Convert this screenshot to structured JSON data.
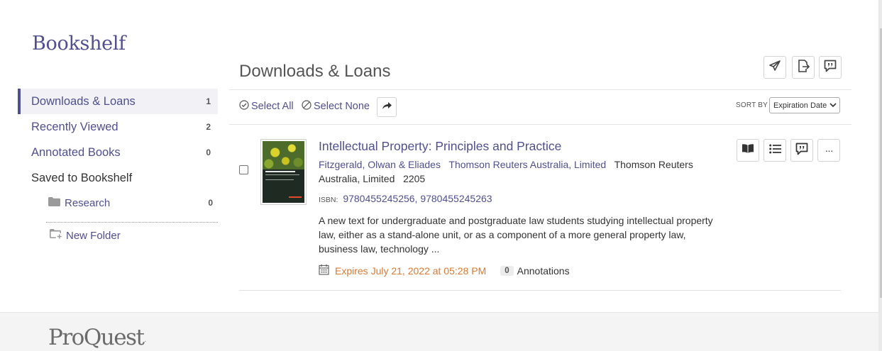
{
  "sidebar": {
    "title": "Bookshelf",
    "items": [
      {
        "label": "Downloads & Loans",
        "count": "1"
      },
      {
        "label": "Recently Viewed",
        "count": "2"
      },
      {
        "label": "Annotated Books",
        "count": "0"
      }
    ],
    "saved_label": "Saved to Bookshelf",
    "folders": [
      {
        "label": "Research",
        "count": "0"
      }
    ],
    "new_folder_label": "New Folder"
  },
  "main": {
    "title": "Downloads & Loans",
    "header_actions": [
      "send-icon",
      "export-icon",
      "feedback-icon"
    ],
    "toolbar": {
      "select_all": "Select All",
      "select_none": "Select None",
      "sort_by_label": "SORT BY",
      "sort_value": "Expiration Date"
    },
    "book": {
      "title": "Intellectual Property: Principles and Practice",
      "authors": "Fitzgerald, Olwan & Eliades",
      "publisher_link": "Thomson Reuters Australia, Limited",
      "publisher_text": "Thomson Reuters Australia, Limited",
      "year": "2205",
      "isbn_label": "ISBN:",
      "isbn": "9780455245256, 9780455245263",
      "description": "A new text for undergraduate and postgraduate law students studying intellectual property law, either as a stand-alone unit, or as a component of a more general property law, business law, technology ...",
      "expires": "Expires July 21, 2022 at 05:28 PM",
      "annotations_count": "0",
      "annotations_label": "Annotations",
      "item_actions": [
        "read-icon",
        "toc-icon",
        "annotations-icon",
        "more-icon"
      ],
      "more_label": "···"
    }
  },
  "footer": {
    "logo": "ProQuest",
    "trademark": "."
  },
  "colors": {
    "accent": "#4f4f91",
    "expires": "#e0792f"
  }
}
